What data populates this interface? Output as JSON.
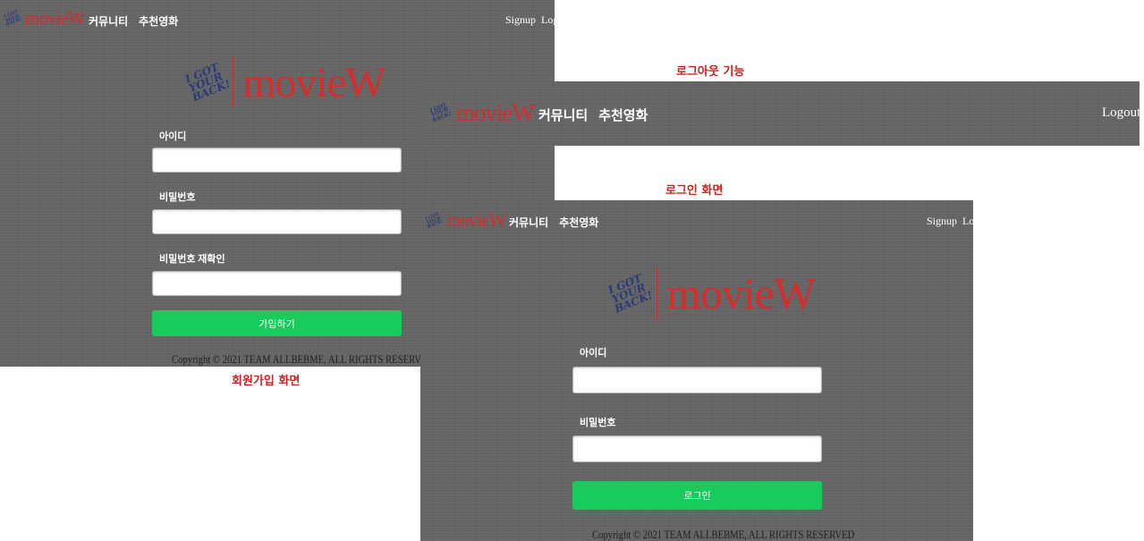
{
  "captions": {
    "logout": "로그아웃 기능",
    "login": "로그인 화면",
    "signup": "회원가입 화면"
  },
  "brand": {
    "name": "movieW",
    "signature": "I GOT YOUR BACK!",
    "color": "#d62c2c"
  },
  "nav": {
    "menu": [
      "커뮤니티",
      "추천영화"
    ],
    "signup": "Signup",
    "login": "Login",
    "logout": "Logout"
  },
  "signup_form": {
    "id_label": "아이디",
    "password_label": "비밀번호",
    "password_confirm_label": "비밀번호 재확인",
    "submit_label": "가입하기"
  },
  "login_form": {
    "id_label": "아이디",
    "password_label": "비밀번호",
    "submit_label": "로그인"
  },
  "footer": {
    "copyright": "Copyright © 2021 TEAM ALLBEBME, ALL RIGHTS RESERVED"
  },
  "colors": {
    "panel_bg": "#666666",
    "button_green": "#18cc5c",
    "caption_red": "#d11f1f"
  }
}
